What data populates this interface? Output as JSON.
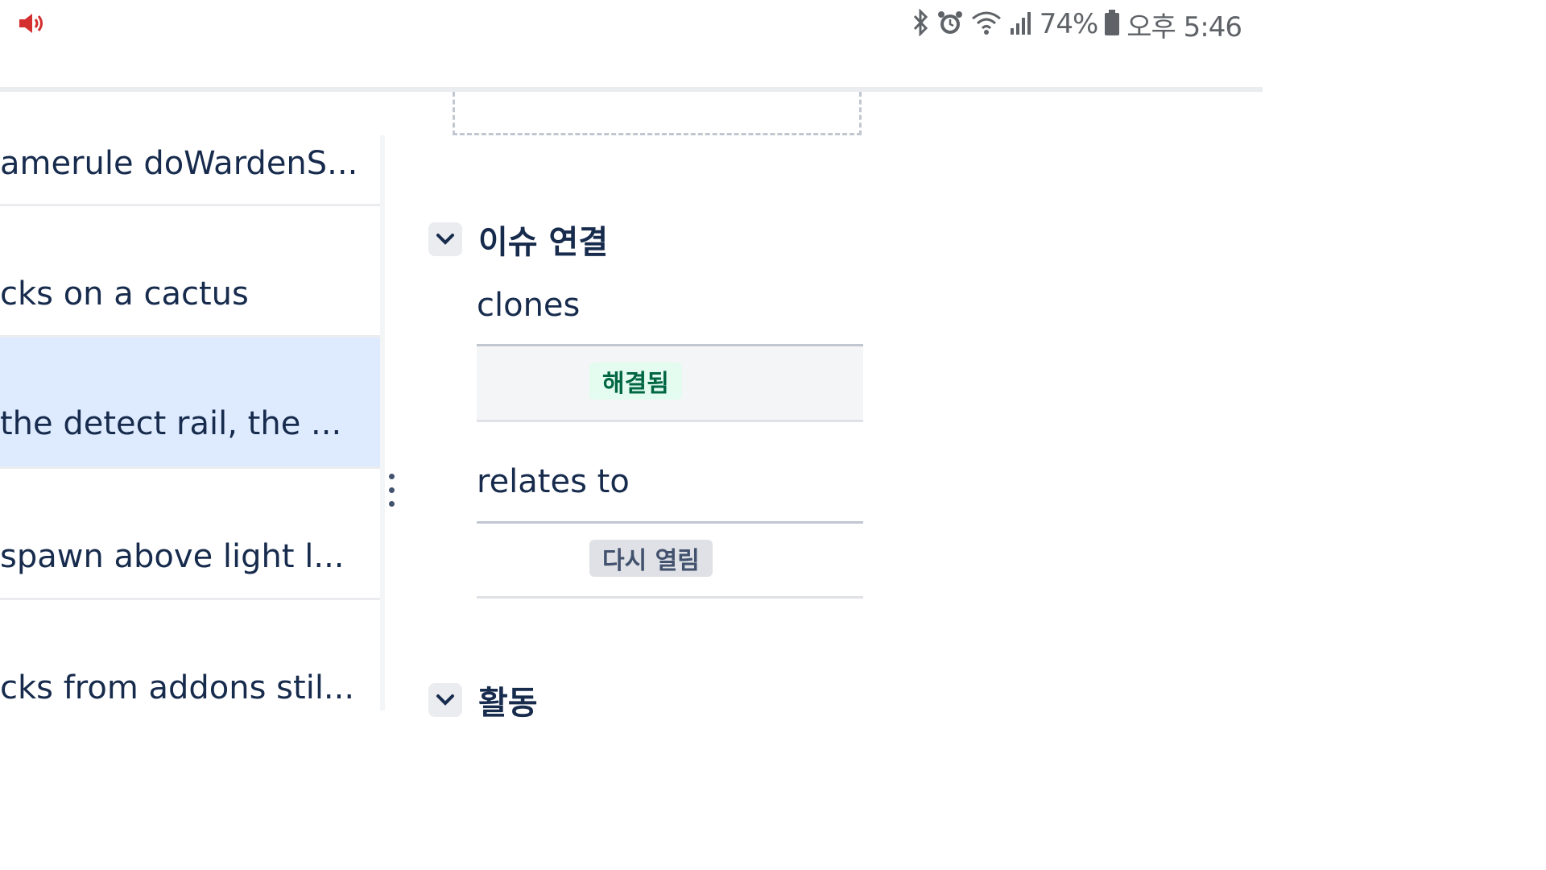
{
  "status_bar": {
    "battery_percent": "74%",
    "time": "오후 5:46",
    "icons": [
      "volume-icon",
      "bluetooth-icon",
      "alarm-icon",
      "wifi-icon",
      "signal-icon",
      "battery-icon"
    ]
  },
  "issue_list": {
    "rows": [
      {
        "text": "amerule doWardenS..."
      },
      {
        "text": "cks on a cactus"
      },
      {
        "text": " the detect rail, the ..."
      },
      {
        "text": "spawn above light l..."
      },
      {
        "text": "cks from addons stil..."
      }
    ],
    "selected_index": 2
  },
  "detail": {
    "issue_links": {
      "title": "이슈 연결",
      "groups": [
        {
          "type": "clones",
          "status": "해결됨",
          "status_color": "#006644"
        },
        {
          "type": "relates to",
          "status": "다시 열림",
          "status_color": "#42526e"
        }
      ]
    },
    "activity": {
      "title": "활동"
    }
  },
  "colors": {
    "selected_row": "#deebff",
    "text": "#172b4d"
  }
}
